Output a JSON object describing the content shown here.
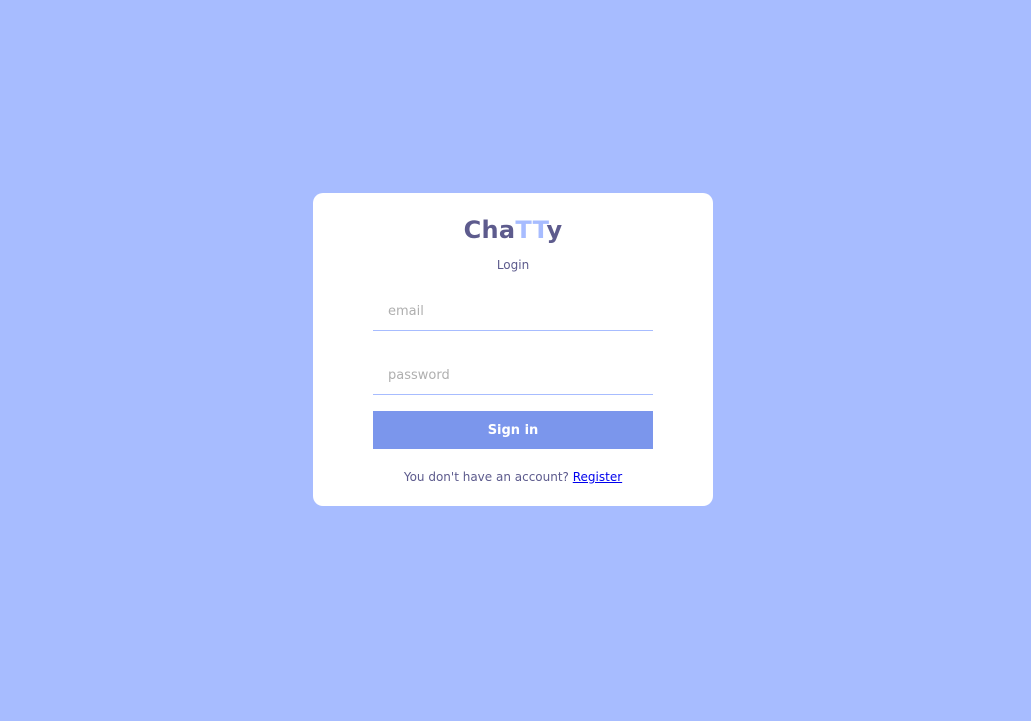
{
  "app": {
    "logo_prefix": "Cha",
    "logo_accent": "TT",
    "logo_suffix": "y",
    "subtitle": "Login"
  },
  "form": {
    "email_placeholder": "email",
    "email_value": "",
    "password_placeholder": "password",
    "password_value": "",
    "signin_label": "Sign in"
  },
  "footer": {
    "prompt": "You don't have an account?",
    "register_link": "Register"
  },
  "colors": {
    "background": "#a7bcff",
    "card": "#ffffff",
    "text": "#5d5b8d",
    "accent": "#a7bcff",
    "button": "#7b96ec",
    "link": "#0000ee"
  }
}
